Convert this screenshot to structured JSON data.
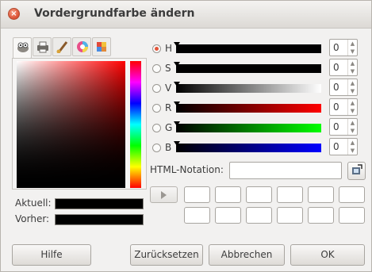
{
  "window": {
    "title": "Vordergrundfarbe ändern"
  },
  "tabs": [
    {
      "icon": "gimp-wilber-icon",
      "active": true
    },
    {
      "icon": "printer-icon",
      "active": false
    },
    {
      "icon": "paintbrush-icon",
      "active": false
    },
    {
      "icon": "color-wheel-icon",
      "active": false
    },
    {
      "icon": "palette-icon",
      "active": false
    }
  ],
  "current": {
    "label": "Aktuell:",
    "color": "#000000"
  },
  "previous": {
    "label": "Vorher:",
    "color": "#000000"
  },
  "channels": [
    {
      "label": "H",
      "value": "0",
      "selected": true
    },
    {
      "label": "S",
      "value": "0",
      "selected": false
    },
    {
      "label": "V",
      "value": "0",
      "selected": false
    },
    {
      "label": "R",
      "value": "0",
      "selected": false
    },
    {
      "label": "G",
      "value": "0",
      "selected": false
    },
    {
      "label": "B",
      "value": "0",
      "selected": false
    }
  ],
  "html_notation": {
    "label": "HTML-Notation:",
    "value": ""
  },
  "buttons": {
    "help": "Hilfe",
    "reset": "Zurücksetzen",
    "cancel": "Abbrechen",
    "ok": "OK"
  },
  "colors": {
    "accent": "#e2543a",
    "red": "#ff0000",
    "green": "#00ff00",
    "blue": "#0000ff"
  }
}
